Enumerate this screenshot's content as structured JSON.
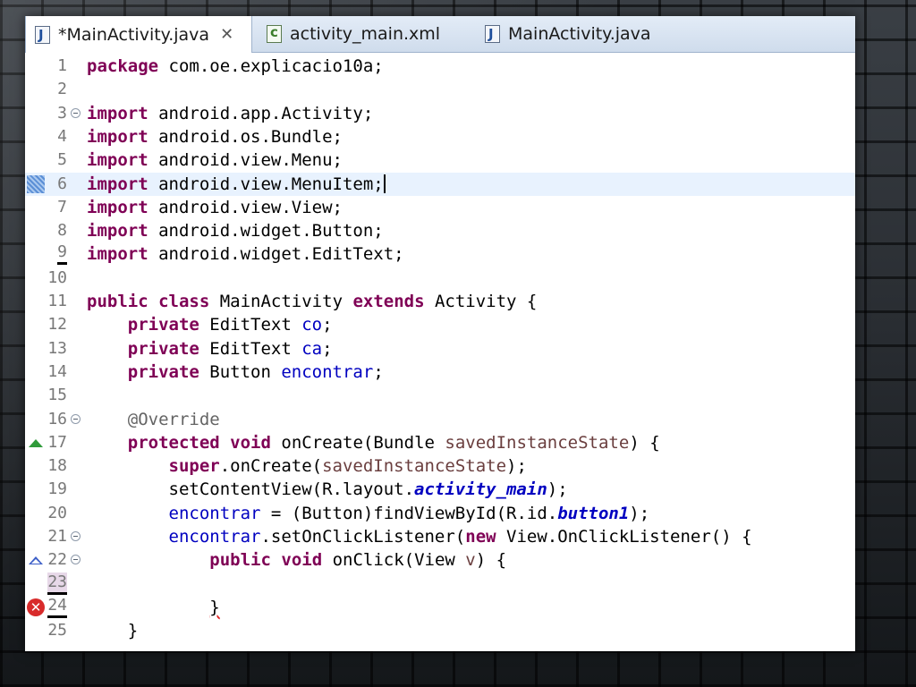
{
  "tabs": [
    {
      "label": "*MainActivity.java",
      "icon": "java-file-icon",
      "active": true,
      "close": "✕"
    },
    {
      "label": "activity_main.xml",
      "icon": "xml-file-icon",
      "active": false
    },
    {
      "label": "MainActivity.java",
      "icon": "java-file-icon",
      "active": false
    }
  ],
  "editor": {
    "lines": [
      {
        "n": "1",
        "code": [
          [
            "kw",
            "package"
          ],
          [
            "p",
            " com.oe.explicacio10a;"
          ]
        ]
      },
      {
        "n": "2",
        "code": []
      },
      {
        "n": "3",
        "code": [
          [
            "kw",
            "import"
          ],
          [
            "p",
            " android.app.Activity;"
          ]
        ]
      },
      {
        "n": "4",
        "code": [
          [
            "kw",
            "import"
          ],
          [
            "p",
            " android.os.Bundle;"
          ]
        ]
      },
      {
        "n": "5",
        "code": [
          [
            "kw",
            "import"
          ],
          [
            "p",
            " android.view.Menu;"
          ]
        ]
      },
      {
        "n": "6",
        "code": [
          [
            "kw",
            "import"
          ],
          [
            "p",
            " android.view.MenuItem;"
          ]
        ]
      },
      {
        "n": "7",
        "code": [
          [
            "kw",
            "import"
          ],
          [
            "p",
            " android.view.View;"
          ]
        ]
      },
      {
        "n": "8",
        "code": [
          [
            "kw",
            "import"
          ],
          [
            "p",
            " android.widget.Button;"
          ]
        ]
      },
      {
        "n": "9",
        "code": [
          [
            "kw",
            "import"
          ],
          [
            "p",
            " android.widget.EditText;"
          ]
        ]
      },
      {
        "n": "10",
        "code": []
      },
      {
        "n": "11",
        "code": [
          [
            "kw",
            "public"
          ],
          [
            "p",
            " "
          ],
          [
            "kw",
            "class"
          ],
          [
            "p",
            " MainActivity "
          ],
          [
            "kw",
            "extends"
          ],
          [
            "p",
            " Activity {"
          ]
        ]
      },
      {
        "n": "12",
        "code": [
          [
            "p",
            "    "
          ],
          [
            "kw",
            "private"
          ],
          [
            "p",
            " EditText "
          ],
          [
            "fld",
            "co"
          ],
          [
            "p",
            ";"
          ]
        ]
      },
      {
        "n": "13",
        "code": [
          [
            "p",
            "    "
          ],
          [
            "kw",
            "private"
          ],
          [
            "p",
            " EditText "
          ],
          [
            "fld",
            "ca"
          ],
          [
            "p",
            ";"
          ]
        ]
      },
      {
        "n": "14",
        "code": [
          [
            "p",
            "    "
          ],
          [
            "kw",
            "private"
          ],
          [
            "p",
            " Button "
          ],
          [
            "fld",
            "encontrar"
          ],
          [
            "p",
            ";"
          ]
        ]
      },
      {
        "n": "15",
        "code": []
      },
      {
        "n": "16",
        "code": [
          [
            "p",
            "    "
          ],
          [
            "ann",
            "@Override"
          ]
        ]
      },
      {
        "n": "17",
        "code": [
          [
            "p",
            "    "
          ],
          [
            "kw",
            "protected"
          ],
          [
            "p",
            " "
          ],
          [
            "kw",
            "void"
          ],
          [
            "p",
            " onCreate(Bundle "
          ],
          [
            "param",
            "savedInstanceState"
          ],
          [
            "p",
            ") {"
          ]
        ]
      },
      {
        "n": "18",
        "code": [
          [
            "p",
            "        "
          ],
          [
            "kw",
            "super"
          ],
          [
            "p",
            ".onCreate("
          ],
          [
            "param",
            "savedInstanceState"
          ],
          [
            "p",
            ");"
          ]
        ]
      },
      {
        "n": "19",
        "code": [
          [
            "p",
            "        setContentView(R.layout."
          ],
          [
            "sfld",
            "activity_main"
          ],
          [
            "p",
            ");"
          ]
        ]
      },
      {
        "n": "20",
        "code": [
          [
            "p",
            "        "
          ],
          [
            "fld",
            "encontrar"
          ],
          [
            "p",
            " = (Button)findViewById(R.id."
          ],
          [
            "sfld",
            "button1"
          ],
          [
            "p",
            ");"
          ]
        ]
      },
      {
        "n": "21",
        "code": [
          [
            "p",
            "        "
          ],
          [
            "fld",
            "encontrar"
          ],
          [
            "p",
            ".setOnClickListener("
          ],
          [
            "kw",
            "new"
          ],
          [
            "p",
            " View.OnClickListener() {"
          ]
        ]
      },
      {
        "n": "22",
        "code": [
          [
            "p",
            "            "
          ],
          [
            "kw",
            "public"
          ],
          [
            "p",
            " "
          ],
          [
            "kw",
            "void"
          ],
          [
            "p",
            " onClick(View "
          ],
          [
            "param",
            "v"
          ],
          [
            "p",
            ") {"
          ]
        ]
      },
      {
        "n": "23",
        "code": []
      },
      {
        "n": "24",
        "code": [
          [
            "p",
            "            "
          ],
          [
            "errsq",
            "}"
          ]
        ]
      },
      {
        "n": "25",
        "code": [
          [
            "p",
            "    }"
          ]
        ]
      }
    ]
  },
  "colors": {
    "keyword": "#7f0055",
    "field": "#0000c0",
    "annotation": "#646464",
    "current_line": "#e8f2fe"
  }
}
